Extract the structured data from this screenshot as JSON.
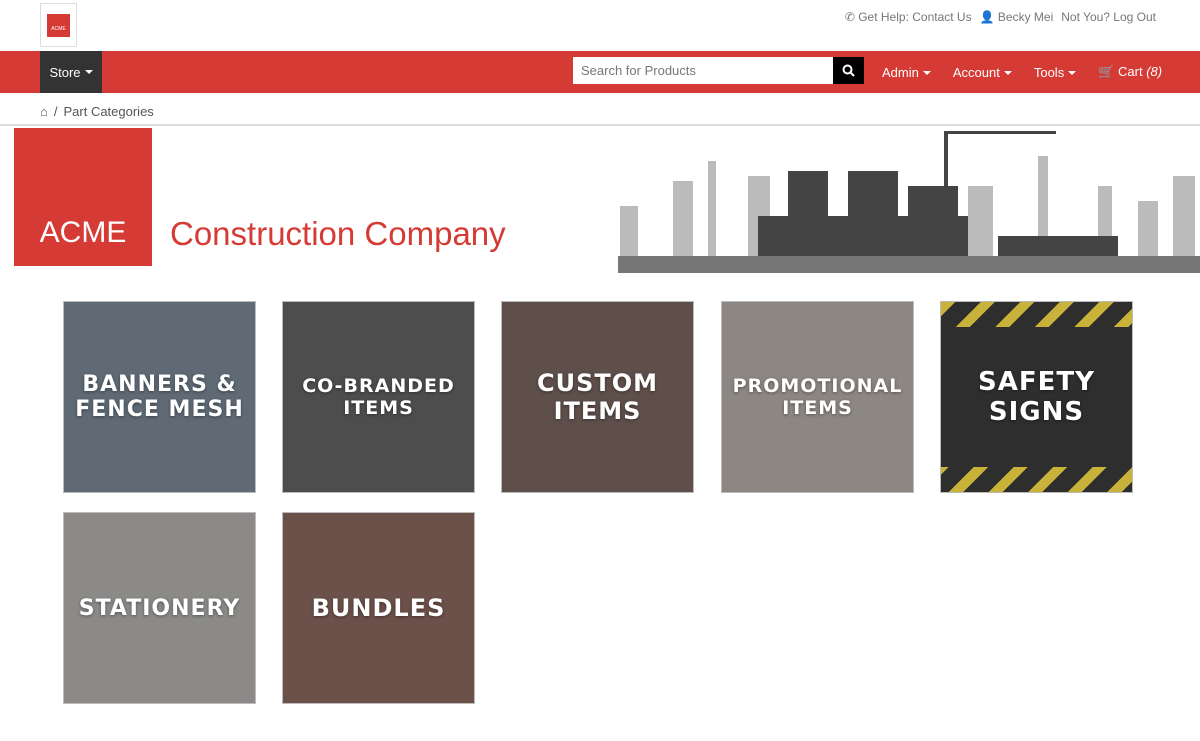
{
  "header": {
    "logo_text": "ACME",
    "help": "Get Help: Contact Us",
    "user": "Becky Mei",
    "logout": "Not You? Log Out"
  },
  "nav": {
    "store": "Store",
    "search_placeholder": "Search for Products",
    "admin": "Admin",
    "account": "Account",
    "tools": "Tools",
    "cart": "Cart",
    "cart_count": "(8)"
  },
  "breadcrumb": {
    "current": "Part Categories"
  },
  "banner": {
    "logo": "ACME",
    "company": "Construction Company"
  },
  "categories": [
    {
      "label": "BANNERS & FENCE MESH",
      "color": "#5f6a75"
    },
    {
      "label": "CO-BRANDED ITEMS",
      "color": "#4d4d4d"
    },
    {
      "label": "CUSTOM ITEMS",
      "color": "#5e4f4a"
    },
    {
      "label": "PROMOTIONAL ITEMS",
      "color": "#8c8782"
    },
    {
      "label": "SAFETY SIGNS",
      "color": "#2e2e2e"
    },
    {
      "label": "STATIONERY",
      "color": "#8b8a88"
    },
    {
      "label": "BUNDLES",
      "color": "#6b5149"
    }
  ]
}
